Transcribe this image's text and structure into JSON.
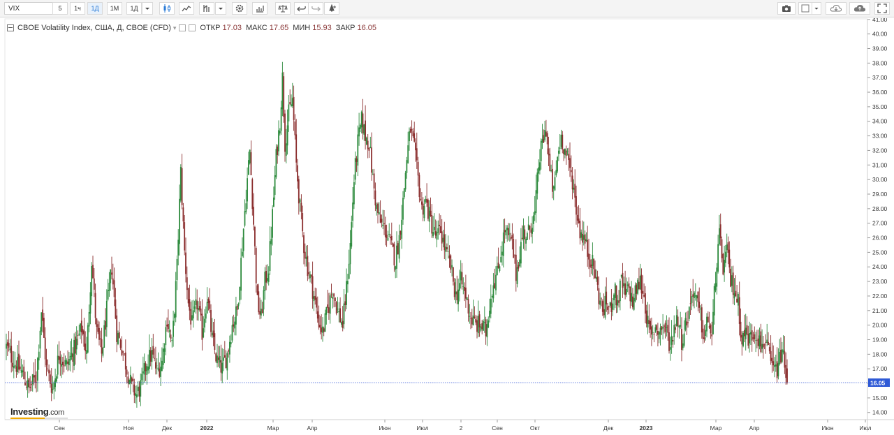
{
  "toolbar": {
    "symbol": "VIX",
    "timeframes": [
      "5",
      "1ч",
      "1Д",
      "1М",
      "1Д"
    ],
    "active_timeframe_index": 2,
    "icons_left": [
      "dropdown-arrow-icon",
      "candlestick-icon",
      "line-chart-icon",
      "indicator-icon",
      "dropdown-arrow-icon",
      "gear-icon",
      "bar-chart-icon",
      "scales-icon",
      "undo-icon",
      "redo-icon",
      "alert-icon"
    ],
    "icons_right": [
      "camera-icon",
      "square-icon",
      "dropdown-arrow-icon",
      "cloud-download-icon",
      "cloud-upload-icon",
      "fullscreen-icon"
    ]
  },
  "legend": {
    "title": "CBOE Volatility Index, США, Д, CBOE (CFD)",
    "open_label": "ОТКР",
    "open_value": "17.03",
    "high_label": "МАКС",
    "high_value": "17.65",
    "low_label": "МИН",
    "low_value": "15.93",
    "close_label": "ЗАКР",
    "close_value": "16.05"
  },
  "logo": {
    "main": "Investing",
    "suffix": ".com"
  },
  "colors": {
    "up": "#2e8b3e",
    "down": "#8b2e2e",
    "last_price_line": "#3d5fd9",
    "last_price_badge": "#2f5ad6"
  },
  "chart_data": {
    "type": "candlestick",
    "title": "CBOE Volatility Index, США, Д, CBOE (CFD)",
    "xlabel": "",
    "ylabel": "",
    "ylim": [
      13.3,
      41.8
    ],
    "y_ticks": [
      14,
      15,
      16,
      17,
      18,
      19,
      20,
      21,
      22,
      23,
      24,
      25,
      26,
      27,
      28,
      29,
      30,
      31,
      32,
      33,
      34,
      35,
      36,
      37,
      38,
      39,
      40,
      41
    ],
    "y_tick_labels": [
      "14.00",
      "15.00",
      "16.00",
      "17.00",
      "18.00",
      "19.00",
      "20.00",
      "21.00",
      "22.00",
      "23.00",
      "24.00",
      "25.00",
      "26.00",
      "27.00",
      "28.00",
      "29.00",
      "30.00",
      "31.00",
      "32.00",
      "33.00",
      "34.00",
      "35.00",
      "36.00",
      "37.00",
      "38.00",
      "39.00",
      "40.00",
      "41.00"
    ],
    "x_tick_labels": [
      "Сен",
      "Ноя",
      "Дек",
      "2022",
      "Мар",
      "Апр",
      "Июн",
      "Июл",
      "2",
      "Сен",
      "Окт",
      "Дек",
      "2023",
      "Мар",
      "Апр",
      "Июн",
      "Июл"
    ],
    "bold_x_labels": [
      "2022",
      "2023"
    ],
    "last_price": 16.05,
    "last_price_label": "16.05",
    "anchors": [
      [
        0,
        18.5
      ],
      [
        6,
        17.5
      ],
      [
        12,
        16.8
      ],
      [
        18,
        15.6
      ],
      [
        24,
        16.5
      ],
      [
        28,
        21.0
      ],
      [
        32,
        17.0
      ],
      [
        37,
        15.6
      ],
      [
        42,
        18.0
      ],
      [
        48,
        17.2
      ],
      [
        55,
        18.5
      ],
      [
        60,
        19.8
      ],
      [
        64,
        18.0
      ],
      [
        68,
        24.5
      ],
      [
        72,
        19.5
      ],
      [
        76,
        18.0
      ],
      [
        80,
        21.0
      ],
      [
        84,
        24.0
      ],
      [
        88,
        19.5
      ],
      [
        92,
        18.5
      ],
      [
        96,
        17.0
      ],
      [
        100,
        15.7
      ],
      [
        104,
        15.2
      ],
      [
        108,
        16.0
      ],
      [
        112,
        17.5
      ],
      [
        116,
        18.0
      ],
      [
        120,
        16.8
      ],
      [
        124,
        17.5
      ],
      [
        128,
        20.5
      ],
      [
        132,
        18.5
      ],
      [
        136,
        24.0
      ],
      [
        139,
        30.5
      ],
      [
        142,
        25.0
      ],
      [
        145,
        21.5
      ],
      [
        148,
        20.0
      ],
      [
        152,
        21.5
      ],
      [
        156,
        19.5
      ],
      [
        160,
        22.0
      ],
      [
        164,
        19.0
      ],
      [
        168,
        17.5
      ],
      [
        172,
        17.0
      ],
      [
        176,
        18.0
      ],
      [
        180,
        20.0
      ],
      [
        184,
        21.0
      ],
      [
        188,
        25.5
      ],
      [
        191,
        29.0
      ],
      [
        194,
        32.0
      ],
      [
        197,
        27.0
      ],
      [
        200,
        21.5
      ],
      [
        203,
        20.5
      ],
      [
        206,
        23.0
      ],
      [
        209,
        24.0
      ],
      [
        212,
        27.5
      ],
      [
        215,
        31.5
      ],
      [
        218,
        34.0
      ],
      [
        220,
        37.0
      ],
      [
        222,
        32.5
      ],
      [
        225,
        34.5
      ],
      [
        228,
        35.5
      ],
      [
        231,
        31.0
      ],
      [
        234,
        28.0
      ],
      [
        237,
        25.5
      ],
      [
        240,
        24.0
      ],
      [
        244,
        22.5
      ],
      [
        248,
        20.5
      ],
      [
        252,
        19.5
      ],
      [
        256,
        21.0
      ],
      [
        260,
        22.5
      ],
      [
        264,
        21.0
      ],
      [
        268,
        20.0
      ],
      [
        271,
        22.5
      ],
      [
        274,
        25.5
      ],
      [
        277,
        30.0
      ],
      [
        280,
        32.5
      ],
      [
        283,
        34.0
      ],
      [
        286,
        33.0
      ],
      [
        289,
        32.5
      ],
      [
        292,
        30.0
      ],
      [
        295,
        28.0
      ],
      [
        298,
        27.0
      ],
      [
        302,
        26.5
      ],
      [
        306,
        25.5
      ],
      [
        310,
        24.5
      ],
      [
        313,
        26.0
      ],
      [
        316,
        28.5
      ],
      [
        319,
        31.5
      ],
      [
        322,
        33.5
      ],
      [
        325,
        32.0
      ],
      [
        328,
        30.0
      ],
      [
        331,
        28.0
      ],
      [
        334,
        28.5
      ],
      [
        337,
        27.5
      ],
      [
        340,
        26.5
      ],
      [
        343,
        26.0
      ],
      [
        346,
        26.5
      ],
      [
        350,
        25.0
      ],
      [
        354,
        24.0
      ],
      [
        358,
        22.0
      ],
      [
        362,
        23.0
      ],
      [
        366,
        22.0
      ],
      [
        370,
        20.5
      ],
      [
        374,
        20.0
      ],
      [
        378,
        20.0
      ],
      [
        382,
        19.5
      ],
      [
        385,
        21.5
      ],
      [
        388,
        23.0
      ],
      [
        391,
        23.5
      ],
      [
        394,
        25.0
      ],
      [
        397,
        26.5
      ],
      [
        400,
        26.0
      ],
      [
        403,
        25.5
      ],
      [
        406,
        23.5
      ],
      [
        409,
        25.0
      ],
      [
        412,
        26.5
      ],
      [
        415,
        26.0
      ],
      [
        418,
        27.0
      ],
      [
        421,
        27.5
      ],
      [
        424,
        31.0
      ],
      [
        427,
        32.5
      ],
      [
        430,
        33.5
      ],
      [
        433,
        30.5
      ],
      [
        436,
        29.0
      ],
      [
        439,
        31.5
      ],
      [
        442,
        33.0
      ],
      [
        445,
        32.0
      ],
      [
        448,
        31.0
      ],
      [
        451,
        30.0
      ],
      [
        454,
        28.0
      ],
      [
        457,
        26.5
      ],
      [
        460,
        26.0
      ],
      [
        463,
        25.0
      ],
      [
        466,
        24.5
      ],
      [
        469,
        23.5
      ],
      [
        472,
        22.0
      ],
      [
        475,
        21.0
      ],
      [
        478,
        21.5
      ],
      [
        481,
        21.0
      ],
      [
        484,
        22.5
      ],
      [
        487,
        21.5
      ],
      [
        490,
        23.0
      ],
      [
        493,
        22.0
      ],
      [
        496,
        22.5
      ],
      [
        499,
        21.5
      ],
      [
        502,
        22.5
      ],
      [
        505,
        23.0
      ],
      [
        508,
        22.0
      ],
      [
        511,
        20.0
      ],
      [
        514,
        19.0
      ],
      [
        517,
        20.0
      ],
      [
        520,
        19.5
      ],
      [
        523,
        20.0
      ],
      [
        526,
        19.5
      ],
      [
        529,
        18.5
      ],
      [
        532,
        20.0
      ],
      [
        535,
        20.5
      ],
      [
        538,
        19.0
      ],
      [
        541,
        20.0
      ],
      [
        544,
        21.0
      ],
      [
        547,
        22.5
      ],
      [
        550,
        21.5
      ],
      [
        553,
        20.5
      ],
      [
        556,
        19.0
      ],
      [
        559,
        20.5
      ],
      [
        562,
        19.0
      ],
      [
        565,
        23.5
      ],
      [
        568,
        26.0
      ],
      [
        571,
        24.0
      ],
      [
        574,
        25.0
      ],
      [
        577,
        23.0
      ],
      [
        580,
        22.5
      ],
      [
        583,
        21.5
      ],
      [
        586,
        19.0
      ],
      [
        589,
        19.5
      ],
      [
        592,
        19.0
      ],
      [
        595,
        19.5
      ],
      [
        598,
        19.5
      ],
      [
        601,
        18.5
      ],
      [
        604,
        19.0
      ],
      [
        607,
        18.0
      ],
      [
        610,
        17.0
      ],
      [
        613,
        16.8
      ],
      [
        616,
        17.5
      ],
      [
        618,
        18.5
      ],
      [
        620,
        17.0
      ],
      [
        622,
        16.05
      ]
    ]
  }
}
